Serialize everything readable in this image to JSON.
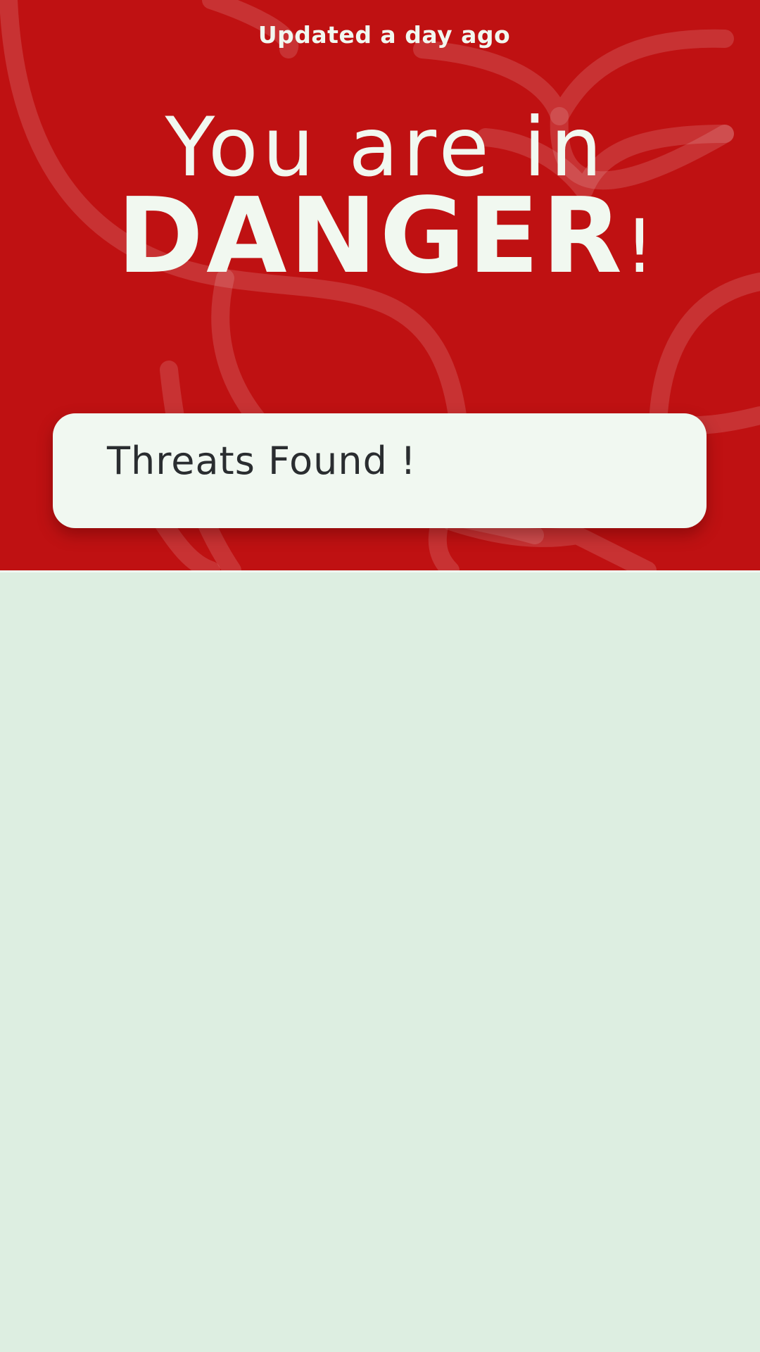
{
  "status": {
    "updated_text": "Updated a day ago",
    "headline_line1": "You are in",
    "headline_word": "DANGER",
    "headline_punct": "!",
    "threat_summary": "Threats Found !"
  },
  "colors": {
    "danger_red": "#bf1112",
    "hero_text": "#f1f8f0",
    "card_background": "#f1f8f1",
    "card_text": "#2a2d30",
    "page_background": "#ddeee1"
  },
  "icons": {
    "hero_background": "leaf-pattern-icon"
  }
}
